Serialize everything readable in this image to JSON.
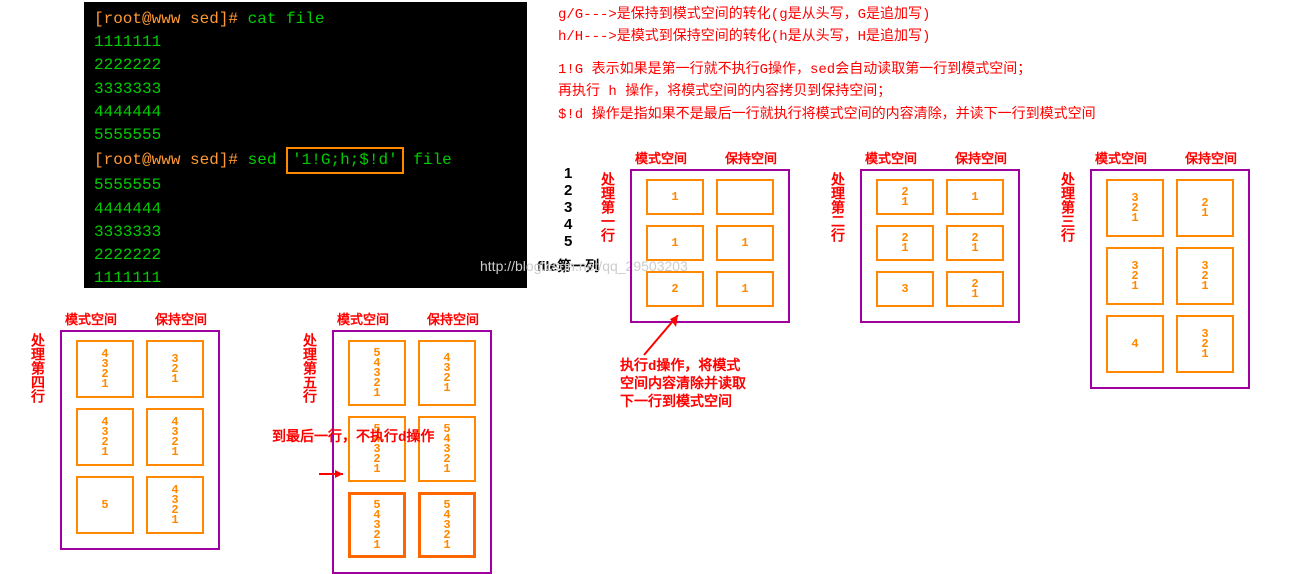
{
  "terminal": {
    "prompt1": "[root@www sed]#",
    "cmd1": "cat file",
    "out1": [
      "1111111",
      "2222222",
      "3333333",
      "4444444",
      "5555555"
    ],
    "prompt2": "[root@www sed]#",
    "cmd2_pre": "sed",
    "cmd2_script": "'1!G;h;$!d'",
    "cmd2_post": "file",
    "out2": [
      "5555555",
      "4444444",
      "3333333",
      "2222222",
      "1111111"
    ]
  },
  "notes": {
    "l1": "g/G--->是保持到模式空间的转化(g是从头写，G是追加写)",
    "l2": "h/H--->是模式到保持空间的转化(h是从头写，H是追加写)",
    "l3": "1!G 表示如果是第一行就不执行G操作，sed会自动读取第一行到模式空间；",
    "l4": "再执行 h 操作，将模式空间的内容拷贝到保持空间；",
    "l5": "$!d 操作是指如果不是最后一行就执行将模式空间的内容清除，并读下一行到模式空间"
  },
  "filecol": {
    "nums": [
      "1",
      "2",
      "3",
      "4",
      "5"
    ],
    "label": "file第一列"
  },
  "labels": {
    "stage1": "处理第一行",
    "stage2": "处理第二行",
    "stage3": "处理第三行",
    "stage4": "处理第四行",
    "stage5": "处理第五行",
    "stage5b": "到最后一行，不执行d操作"
  },
  "headers": {
    "pattern": "模式空间",
    "hold": "保持空间"
  },
  "cells": {
    "s1": {
      "r1p": "1",
      "r1h": "",
      "r2p": "1",
      "r2h": "1",
      "r3p": "2",
      "r3h": "1"
    },
    "s2": {
      "r1p": [
        "2",
        "1"
      ],
      "r1h": "1",
      "r2p": [
        "2",
        "1"
      ],
      "r2h": [
        "2",
        "1"
      ],
      "r3p": "3",
      "r3h": [
        "2",
        "1"
      ]
    },
    "s3": {
      "r1p": [
        "3",
        "2",
        "1"
      ],
      "r1h": [
        "2",
        "1"
      ],
      "r2p": [
        "3",
        "2",
        "1"
      ],
      "r2h": [
        "3",
        "2",
        "1"
      ],
      "r3p": "4",
      "r3h": [
        "3",
        "2",
        "1"
      ]
    },
    "s4": {
      "r1p": [
        "4",
        "3",
        "2",
        "1"
      ],
      "r1h": [
        "3",
        "2",
        "1"
      ],
      "r2p": [
        "4",
        "3",
        "2",
        "1"
      ],
      "r2h": [
        "4",
        "3",
        "2",
        "1"
      ],
      "r3p": "5",
      "r3h": [
        "4",
        "3",
        "2",
        "1"
      ]
    },
    "s5": {
      "r1p": [
        "5",
        "4",
        "3",
        "2",
        "1"
      ],
      "r1h": [
        "4",
        "3",
        "2",
        "1"
      ],
      "r2p": [
        "5",
        "4",
        "3",
        "2",
        "1"
      ],
      "r2h": [
        "5",
        "4",
        "3",
        "2",
        "1"
      ],
      "r3p": [
        "5",
        "4",
        "3",
        "2",
        "1"
      ],
      "r3h": [
        "5",
        "4",
        "3",
        "2",
        "1"
      ]
    }
  },
  "arrow_note": {
    "l1": "执行d操作，将模式",
    "l2": "空间内容清除并读取",
    "l3": "下一行到模式空间"
  },
  "watermark": "http://blog.csdn.net/qq_29503203"
}
